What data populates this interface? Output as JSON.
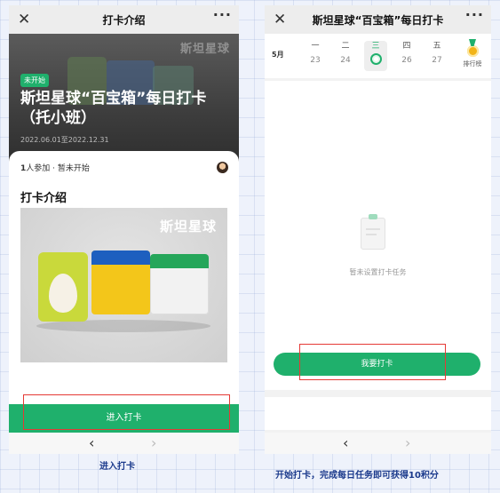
{
  "left": {
    "nav_title": "打卡介绍",
    "close_glyph": "✕",
    "more_glyph": "···",
    "hero": {
      "tag": "未开始",
      "title": "斯坦星球“百宝箱”每日打卡（托小班）",
      "date": "2022.06.01至2022.12.31",
      "logo": "斯坦星球"
    },
    "participants_count": "1",
    "participants_text": "人参加 · 暂未开始",
    "section_title": "打卡介绍",
    "product_logo": "斯坦星球",
    "enter_button": "进入打卡",
    "back_glyph": "‹",
    "forward_glyph": "›"
  },
  "right": {
    "nav_title": "斯坦星球“百宝箱”每日打卡",
    "close_glyph": "✕",
    "more_glyph": "···",
    "month": "5月",
    "days": [
      {
        "name": "一",
        "num": "23"
      },
      {
        "name": "二",
        "num": "24"
      },
      {
        "name": "三",
        "num": ""
      },
      {
        "name": "四",
        "num": "26"
      },
      {
        "name": "五",
        "num": "27"
      }
    ],
    "rank_label": "排行榜",
    "empty_text": "暂未设置打卡任务",
    "checkin_button": "我要打卡",
    "back_glyph": "‹",
    "forward_glyph": "›"
  },
  "captions": {
    "left": "进入打卡",
    "right": "开始打卡，完成每日任务即可获得10积分"
  },
  "colors": {
    "accent_green": "#1fb06c",
    "highlight_red": "#e53935",
    "caption_blue": "#1b3a8c"
  }
}
